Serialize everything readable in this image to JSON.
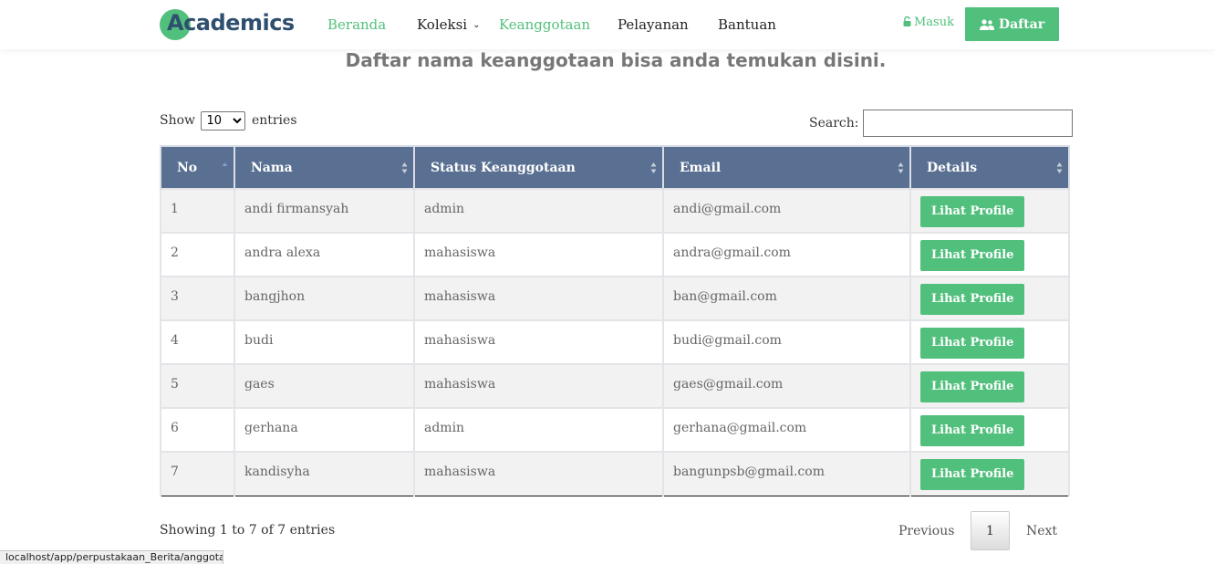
{
  "colors": {
    "accent": "#52c07d",
    "table_header": "#5a7092",
    "logo_dark": "#2f4f6f"
  },
  "brand": {
    "logo_text": "Academics"
  },
  "nav": {
    "items": [
      {
        "label": "Beranda",
        "active": true
      },
      {
        "label": "Koleksi",
        "has_dropdown": true
      },
      {
        "label": "Keanggotaan",
        "active": true
      },
      {
        "label": "Pelayanan"
      },
      {
        "label": "Bantuan"
      }
    ],
    "login_label": "Masuk",
    "login_icon": "lock-icon",
    "register_label": "Daftar",
    "register_icon": "users-icon"
  },
  "page": {
    "subtitle": "Daftar nama keanggotaan bisa anda temukan disini."
  },
  "controls": {
    "show_label": "Show",
    "entries_label": "entries",
    "page_length": "10",
    "search_label": "Search:",
    "search_value": ""
  },
  "table": {
    "headers": [
      "No",
      "Nama",
      "Status Keanggotaan",
      "Email",
      "Details"
    ],
    "sorted_column": "No",
    "rows": [
      {
        "no": "1",
        "nama": "andi firmansyah",
        "status": "admin",
        "email": "andi@gmail.com",
        "action": "Lihat Profile"
      },
      {
        "no": "2",
        "nama": "andra alexa",
        "status": "mahasiswa",
        "email": "andra@gmail.com",
        "action": "Lihat Profile"
      },
      {
        "no": "3",
        "nama": "bangjhon",
        "status": "mahasiswa",
        "email": "ban@gmail.com",
        "action": "Lihat Profile"
      },
      {
        "no": "4",
        "nama": "budi",
        "status": "mahasiswa",
        "email": "budi@gmail.com",
        "action": "Lihat Profile"
      },
      {
        "no": "5",
        "nama": "gaes",
        "status": "mahasiswa",
        "email": "gaes@gmail.com",
        "action": "Lihat Profile"
      },
      {
        "no": "6",
        "nama": "gerhana",
        "status": "admin",
        "email": "gerhana@gmail.com",
        "action": "Lihat Profile"
      },
      {
        "no": "7",
        "nama": "kandisyha",
        "status": "mahasiswa",
        "email": "bangunpsb@gmail.com",
        "action": "Lihat Profile"
      }
    ]
  },
  "footer": {
    "info": "Showing 1 to 7 of 7 entries",
    "previous_label": "Previous",
    "current_page": "1",
    "next_label": "Next"
  },
  "status_bar": {
    "url": "localhost/app/perpustakaan_Berita/anggota"
  }
}
